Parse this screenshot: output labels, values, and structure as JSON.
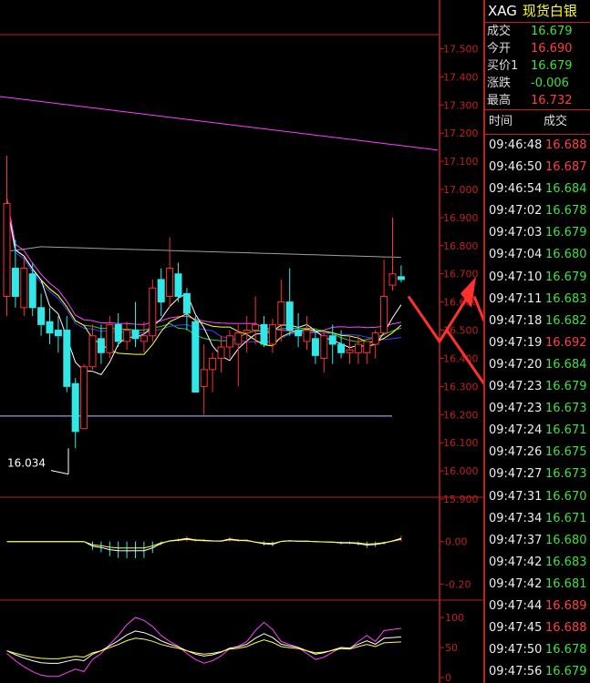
{
  "quote": {
    "symbol": "XAG",
    "name": "现货白银",
    "rows": [
      {
        "label": "成交",
        "value": "16.679",
        "dir": "dn"
      },
      {
        "label": "今开",
        "value": "16.690",
        "dir": "up"
      },
      {
        "label": "买价1",
        "value": "16.679",
        "dir": "dn"
      },
      {
        "label": "涨跌",
        "value": "-0.006",
        "dir": "dn"
      },
      {
        "label": "最高",
        "value": "16.732",
        "dir": "up"
      }
    ]
  },
  "ticks": {
    "header_time": "时间",
    "header_price": "成交",
    "rows": [
      {
        "time": "09:46:48",
        "price": "16.688",
        "dir": "up"
      },
      {
        "time": "09:46:50",
        "price": "16.687",
        "dir": "up"
      },
      {
        "time": "09:46:54",
        "price": "16.684",
        "dir": "dn"
      },
      {
        "time": "09:47:02",
        "price": "16.678",
        "dir": "dn"
      },
      {
        "time": "09:47:03",
        "price": "16.679",
        "dir": "dn"
      },
      {
        "time": "09:47:04",
        "price": "16.680",
        "dir": "dn"
      },
      {
        "time": "09:47:10",
        "price": "16.679",
        "dir": "dn"
      },
      {
        "time": "09:47:11",
        "price": "16.683",
        "dir": "dn"
      },
      {
        "time": "09:47:18",
        "price": "16.682",
        "dir": "dn"
      },
      {
        "time": "09:47:19",
        "price": "16.692",
        "dir": "up"
      },
      {
        "time": "09:47:20",
        "price": "16.684",
        "dir": "dn"
      },
      {
        "time": "09:47:23",
        "price": "16.679",
        "dir": "dn"
      },
      {
        "time": "09:47:23",
        "price": "16.673",
        "dir": "dn"
      },
      {
        "time": "09:47:24",
        "price": "16.671",
        "dir": "dn"
      },
      {
        "time": "09:47:26",
        "price": "16.675",
        "dir": "dn"
      },
      {
        "time": "09:47:27",
        "price": "16.673",
        "dir": "dn"
      },
      {
        "time": "09:47:31",
        "price": "16.670",
        "dir": "dn"
      },
      {
        "time": "09:47:34",
        "price": "16.671",
        "dir": "dn"
      },
      {
        "time": "09:47:37",
        "price": "16.680",
        "dir": "dn"
      },
      {
        "time": "09:47:42",
        "price": "16.683",
        "dir": "dn"
      },
      {
        "time": "09:47:42",
        "price": "16.681",
        "dir": "dn"
      },
      {
        "time": "09:47:44",
        "price": "16.689",
        "dir": "up"
      },
      {
        "time": "09:47:45",
        "price": "16.688",
        "dir": "up"
      },
      {
        "time": "09:47:50",
        "price": "16.678",
        "dir": "dn"
      },
      {
        "time": "09:47:56",
        "price": "16.679",
        "dir": "dn"
      }
    ]
  },
  "chart_data": {
    "type": "candlestick",
    "price_axis": {
      "ticks": [
        "17.500",
        "17.400",
        "17.300",
        "17.200",
        "17.100",
        "17.000",
        "16.900",
        "16.800",
        "16.700",
        "16.600",
        "16.500",
        "16.400",
        "16.300",
        "16.200",
        "16.100",
        "16.000",
        "15.900"
      ],
      "range": [
        15.9,
        17.55
      ]
    },
    "low_marker": "16.034",
    "macd_axis": {
      "ticks": [
        "0.00",
        "-0.20"
      ],
      "range": [
        -0.22,
        0.14
      ]
    },
    "kdj_axis": {
      "ticks": [
        "100",
        "50",
        "0"
      ],
      "range": [
        0,
        100
      ]
    },
    "colors": {
      "up": "#ff3030",
      "down": "#30e8e8",
      "axis": "#c02020",
      "ma_white": "#ffffff",
      "ma_yellow": "#ffff40",
      "ma_magenta": "#ff40ff",
      "ma_green": "#30d030",
      "ma_blue": "#4040ff",
      "ma_gray": "#a0a0a0",
      "arrow": "#ff3030"
    },
    "candles": [
      {
        "o": 16.62,
        "h": 17.12,
        "l": 16.55,
        "c": 16.95
      },
      {
        "o": 16.72,
        "h": 16.82,
        "l": 16.58,
        "c": 16.62
      },
      {
        "o": 16.58,
        "h": 16.76,
        "l": 16.55,
        "c": 16.72
      },
      {
        "o": 16.7,
        "h": 16.74,
        "l": 16.55,
        "c": 16.58
      },
      {
        "o": 16.58,
        "h": 16.63,
        "l": 16.48,
        "c": 16.52
      },
      {
        "o": 16.53,
        "h": 16.58,
        "l": 16.45,
        "c": 16.49
      },
      {
        "o": 16.5,
        "h": 16.55,
        "l": 16.42,
        "c": 16.48
      },
      {
        "o": 16.5,
        "h": 16.55,
        "l": 16.28,
        "c": 16.3
      },
      {
        "o": 16.31,
        "h": 16.33,
        "l": 16.08,
        "c": 16.14
      },
      {
        "o": 16.15,
        "h": 16.38,
        "l": 16.15,
        "c": 16.37
      },
      {
        "o": 16.37,
        "h": 16.52,
        "l": 16.36,
        "c": 16.48
      },
      {
        "o": 16.47,
        "h": 16.52,
        "l": 16.38,
        "c": 16.42
      },
      {
        "o": 16.42,
        "h": 16.55,
        "l": 16.4,
        "c": 16.52
      },
      {
        "o": 16.52,
        "h": 16.56,
        "l": 16.44,
        "c": 16.46
      },
      {
        "o": 16.46,
        "h": 16.53,
        "l": 16.43,
        "c": 16.5
      },
      {
        "o": 16.5,
        "h": 16.6,
        "l": 16.44,
        "c": 16.47
      },
      {
        "o": 16.46,
        "h": 16.53,
        "l": 16.42,
        "c": 16.48
      },
      {
        "o": 16.48,
        "h": 16.68,
        "l": 16.46,
        "c": 16.65
      },
      {
        "o": 16.68,
        "h": 16.72,
        "l": 16.55,
        "c": 16.6
      },
      {
        "o": 16.62,
        "h": 16.83,
        "l": 16.58,
        "c": 16.72
      },
      {
        "o": 16.7,
        "h": 16.74,
        "l": 16.6,
        "c": 16.62
      },
      {
        "o": 16.63,
        "h": 16.65,
        "l": 16.5,
        "c": 16.56
      },
      {
        "o": 16.53,
        "h": 16.55,
        "l": 16.28,
        "c": 16.28
      },
      {
        "o": 16.3,
        "h": 16.45,
        "l": 16.2,
        "c": 16.36
      },
      {
        "o": 16.36,
        "h": 16.42,
        "l": 16.28,
        "c": 16.4
      },
      {
        "o": 16.4,
        "h": 16.48,
        "l": 16.35,
        "c": 16.44
      },
      {
        "o": 16.44,
        "h": 16.5,
        "l": 16.4,
        "c": 16.48
      },
      {
        "o": 16.45,
        "h": 16.52,
        "l": 16.3,
        "c": 16.49
      },
      {
        "o": 16.49,
        "h": 16.55,
        "l": 16.42,
        "c": 16.5
      },
      {
        "o": 16.5,
        "h": 16.62,
        "l": 16.45,
        "c": 16.52
      },
      {
        "o": 16.52,
        "h": 16.55,
        "l": 16.44,
        "c": 16.45
      },
      {
        "o": 16.45,
        "h": 16.54,
        "l": 16.42,
        "c": 16.52
      },
      {
        "o": 16.52,
        "h": 16.68,
        "l": 16.46,
        "c": 16.6
      },
      {
        "o": 16.6,
        "h": 16.72,
        "l": 16.48,
        "c": 16.5
      },
      {
        "o": 16.5,
        "h": 16.56,
        "l": 16.44,
        "c": 16.48
      },
      {
        "o": 16.46,
        "h": 16.55,
        "l": 16.43,
        "c": 16.5
      },
      {
        "o": 16.47,
        "h": 16.5,
        "l": 16.38,
        "c": 16.41
      },
      {
        "o": 16.4,
        "h": 16.5,
        "l": 16.35,
        "c": 16.48
      },
      {
        "o": 16.48,
        "h": 16.52,
        "l": 16.38,
        "c": 16.45
      },
      {
        "o": 16.45,
        "h": 16.5,
        "l": 16.4,
        "c": 16.42
      },
      {
        "o": 16.42,
        "h": 16.48,
        "l": 16.38,
        "c": 16.43
      },
      {
        "o": 16.42,
        "h": 16.48,
        "l": 16.38,
        "c": 16.45
      },
      {
        "o": 16.42,
        "h": 16.46,
        "l": 16.38,
        "c": 16.46
      },
      {
        "o": 16.45,
        "h": 16.5,
        "l": 16.4,
        "c": 16.49
      },
      {
        "o": 16.49,
        "h": 16.75,
        "l": 16.48,
        "c": 16.62
      },
      {
        "o": 16.66,
        "h": 16.9,
        "l": 16.64,
        "c": 16.7
      },
      {
        "o": 16.69,
        "h": 16.73,
        "l": 16.67,
        "c": 16.68
      }
    ]
  }
}
